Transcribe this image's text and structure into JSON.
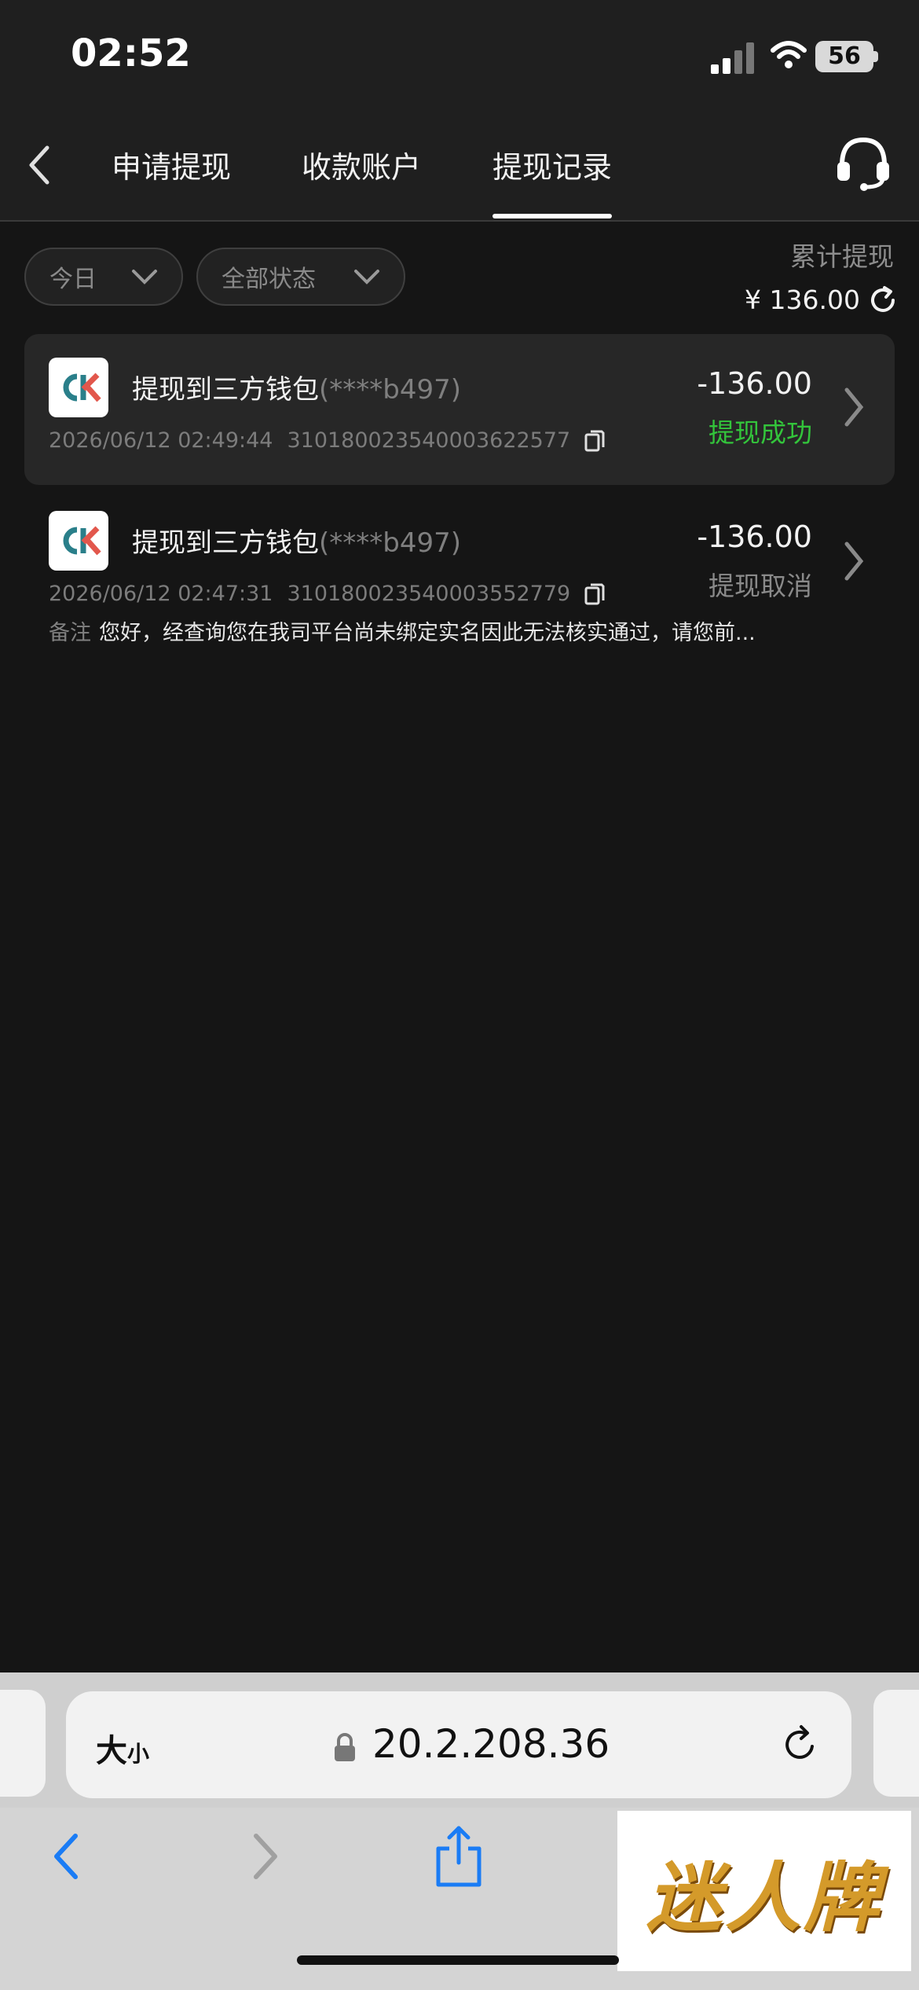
{
  "status_bar": {
    "time": "02:52",
    "battery": "56"
  },
  "header": {
    "tabs": [
      {
        "label": "申请提现"
      },
      {
        "label": "收款账户"
      },
      {
        "label": "提现记录"
      }
    ],
    "active_tab_index": 2
  },
  "filters": {
    "date": "今日",
    "status": "全部状态"
  },
  "summary": {
    "label": "累计提现",
    "amount": "¥ 136.00"
  },
  "records": [
    {
      "title": "提现到三方钱包",
      "account": "(****b497)",
      "datetime": "2026/06/12 02:49:44",
      "order_id": "310180023540003622577",
      "amount": "-136.00",
      "status": "提现成功",
      "status_color": "#33c43b"
    },
    {
      "title": "提现到三方钱包",
      "account": "(****b497)",
      "datetime": "2026/06/12 02:47:31",
      "order_id": "310180023540003552779",
      "amount": "-136.00",
      "status": "提现取消",
      "status_color": "#8a8a8a",
      "remark_label": "备注",
      "remark": "您好，经查询您在我司平台尚未绑定实名因此无法核实通过，请您前..."
    }
  ],
  "browser": {
    "text_size_big": "大",
    "text_size_small": "小",
    "url": "20.2.208.36"
  },
  "watermark": "迷人牌",
  "colors": {
    "background": "#151515",
    "header": "#1f1f1f",
    "success": "#33c43b"
  }
}
